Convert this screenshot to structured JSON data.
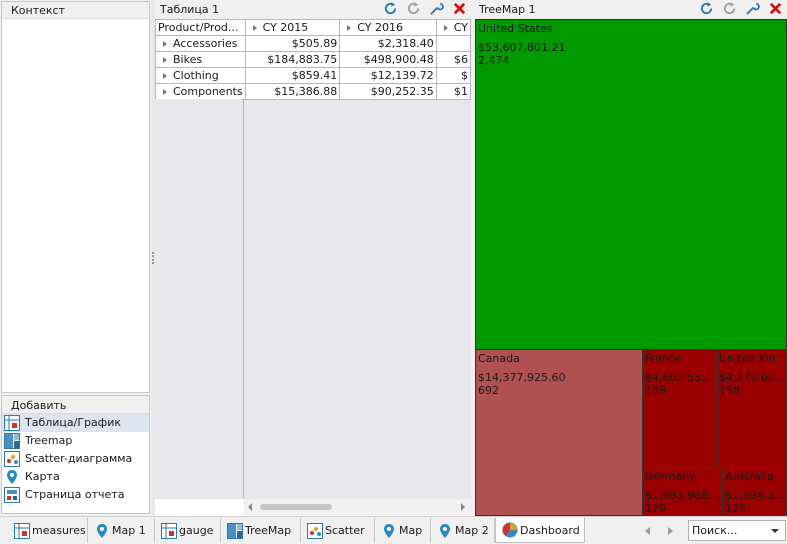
{
  "left": {
    "context_title": "Контекст",
    "add_title": "Добавить",
    "add_items": [
      {
        "label": "Таблица/График",
        "icon": "table-chart-icon"
      },
      {
        "label": "Treemap",
        "icon": "treemap-icon"
      },
      {
        "label": "Scatter-диаграмма",
        "icon": "scatter-icon"
      },
      {
        "label": "Карта",
        "icon": "map-pin-icon"
      },
      {
        "label": "Страница отчета",
        "icon": "report-page-icon"
      }
    ]
  },
  "table_panel": {
    "title": "Таблица 1",
    "corner": "Product/Prod...",
    "columns": [
      "CY 2015",
      "CY 2016",
      "CY"
    ],
    "rows": [
      {
        "label": "Accessories",
        "v1": "$505.89",
        "v2": "$2,318.40",
        "v3": ""
      },
      {
        "label": "Bikes",
        "v1": "$184,883.75",
        "v2": "$498,900.48",
        "v3": "$6"
      },
      {
        "label": "Clothing",
        "v1": "$859.41",
        "v2": "$12,139.72",
        "v3": "$"
      },
      {
        "label": "Components",
        "v1": "$15,386.88",
        "v2": "$90,252.35",
        "v3": "$1"
      }
    ]
  },
  "treemap_panel": {
    "title": "TreeMap 1",
    "tiles": [
      {
        "name": "United States",
        "value": "$53,607,801.21",
        "count": "2,474",
        "color": "#009900"
      },
      {
        "name": "Canada",
        "value": "$14,377,925.60",
        "count": "692",
        "color": "#b05050"
      },
      {
        "name": "France",
        "value": "$4,607,53...",
        "count": "188",
        "color": "#9a0000"
      },
      {
        "name": "United Kin...",
        "value": "$4,279,00...",
        "count": "188",
        "color": "#9a0000"
      },
      {
        "name": "Germany",
        "value": "$1,983,988...",
        "count": "129",
        "color": "#9a0000"
      },
      {
        "name": "Australia",
        "value": "$1,594,3...",
        "count": "125",
        "color": "#9a0000"
      }
    ]
  },
  "tabs": [
    {
      "label": "measures",
      "icon": "table-chart-icon"
    },
    {
      "label": "Map 1",
      "icon": "map-pin-icon"
    },
    {
      "label": "gauge",
      "icon": "table-chart-icon"
    },
    {
      "label": "TreeMap",
      "icon": "treemap-icon"
    },
    {
      "label": "Scatter",
      "icon": "scatter-icon"
    },
    {
      "label": "Map",
      "icon": "map-pin-icon"
    },
    {
      "label": "Map 2",
      "icon": "map-pin-icon"
    },
    {
      "label": "Dashboard",
      "icon": "dashboard-icon"
    }
  ],
  "search": {
    "placeholder": "Поиск..."
  }
}
